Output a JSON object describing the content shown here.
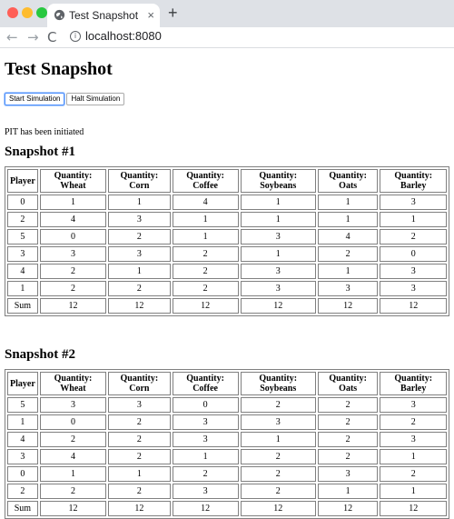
{
  "browser": {
    "tab_title": "Test Snapshot",
    "tab_close": "×",
    "new_tab": "+",
    "url": "localhost:8080",
    "nav_back": "←",
    "nav_forward": "→",
    "reload": "C",
    "info": "i"
  },
  "page": {
    "title": "Test Snapshot",
    "buttons": {
      "start": "Start Simulation",
      "halt": "Halt Simulation"
    },
    "status": "PIT has been initiated"
  },
  "columns": [
    "Player",
    "Quantity: Wheat",
    "Quantity: Corn",
    "Quantity: Coffee",
    "Quantity: Soybeans",
    "Quantity: Oats",
    "Quantity: Barley"
  ],
  "snapshots": [
    {
      "title": "Snapshot #1",
      "rows": [
        [
          "0",
          "1",
          "1",
          "4",
          "1",
          "1",
          "3"
        ],
        [
          "2",
          "4",
          "3",
          "1",
          "1",
          "1",
          "1"
        ],
        [
          "5",
          "0",
          "2",
          "1",
          "3",
          "4",
          "2"
        ],
        [
          "3",
          "3",
          "3",
          "2",
          "1",
          "2",
          "0"
        ],
        [
          "4",
          "2",
          "1",
          "2",
          "3",
          "1",
          "3"
        ],
        [
          "1",
          "2",
          "2",
          "2",
          "3",
          "3",
          "3"
        ]
      ],
      "sum": [
        "Sum",
        "12",
        "12",
        "12",
        "12",
        "12",
        "12"
      ]
    },
    {
      "title": "Snapshot #2",
      "rows": [
        [
          "5",
          "3",
          "3",
          "0",
          "2",
          "2",
          "3"
        ],
        [
          "1",
          "0",
          "2",
          "3",
          "3",
          "2",
          "2"
        ],
        [
          "4",
          "2",
          "2",
          "3",
          "1",
          "2",
          "3"
        ],
        [
          "3",
          "4",
          "2",
          "1",
          "2",
          "2",
          "1"
        ],
        [
          "0",
          "1",
          "1",
          "2",
          "2",
          "3",
          "2"
        ],
        [
          "2",
          "2",
          "2",
          "3",
          "2",
          "1",
          "1"
        ]
      ],
      "sum": [
        "Sum",
        "12",
        "12",
        "12",
        "12",
        "12",
        "12"
      ]
    }
  ],
  "colors": {
    "tabbar": "#dee1e6",
    "focus": "#4d90fe"
  }
}
